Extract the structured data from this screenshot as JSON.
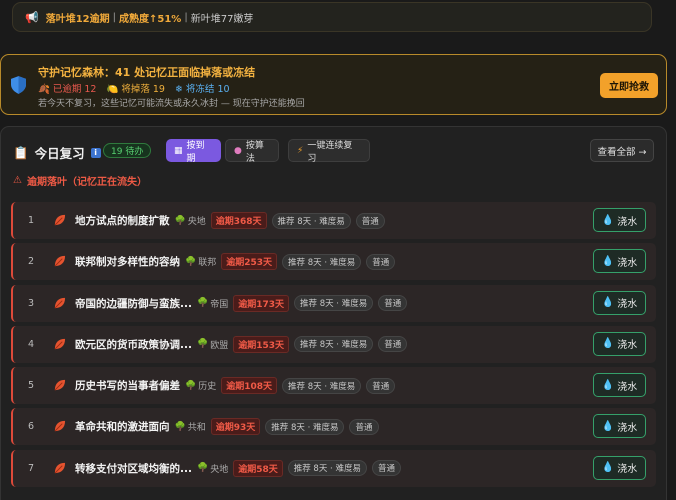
{
  "top_banner": {
    "icon": "megaphone-icon",
    "overdue": "落叶堆12逾期",
    "ripeness": "成熟度↑51%",
    "sprouts": "新叶堆77嫩芽",
    "sep": "|"
  },
  "alert": {
    "title": "守护记忆森林：41 处记忆正面临掉落或冻结",
    "stat_overdue": "已逾期 12",
    "stat_falling": "将掉落 19",
    "stat_frozen": "将冻结 10",
    "subtitle": "若今天不复习，这些记忆可能流失或永久冰封 — 现在守护还能挽回",
    "button": "立即抢救"
  },
  "review": {
    "title": "今日复习",
    "pending": "19 待办",
    "sort_due": "按到期",
    "sort_algo": "按算法",
    "continuous": "一键连续复习",
    "view_all": "查看全部 →",
    "section_title": "逾期落叶（记忆正在流失）",
    "water_label": "浇水",
    "items": [
      {
        "num": "1",
        "name": "地方试点的制度扩散",
        "tree": "央地",
        "overdue": "逾期368天",
        "rec": "推荐 8天 · 难度易",
        "level": "普通"
      },
      {
        "num": "2",
        "name": "联邦制对多样性的容纳",
        "tree": "联邦",
        "overdue": "逾期253天",
        "rec": "推荐 8天 · 难度易",
        "level": "普通"
      },
      {
        "num": "3",
        "name": "帝国的边疆防御与蛮族...",
        "tree": "帝国",
        "overdue": "逾期173天",
        "rec": "推荐 8天 · 难度易",
        "level": "普通"
      },
      {
        "num": "4",
        "name": "欧元区的货币政策协调...",
        "tree": "欧盟",
        "overdue": "逾期153天",
        "rec": "推荐 8天 · 难度易",
        "level": "普通"
      },
      {
        "num": "5",
        "name": "历史书写的当事者偏差",
        "tree": "历史",
        "overdue": "逾期108天",
        "rec": "推荐 8天 · 难度易",
        "level": "普通"
      },
      {
        "num": "6",
        "name": "革命共和的激进面向",
        "tree": "共和",
        "overdue": "逾期93天",
        "rec": "推荐 8天 · 难度易",
        "level": "普通"
      },
      {
        "num": "7",
        "name": "转移支付对区域均衡的...",
        "tree": "央地",
        "overdue": "逾期58天",
        "rec": "推荐 8天 · 难度易",
        "level": "普通"
      }
    ]
  },
  "colors": {
    "accent": "#7b59e0",
    "overdue": "#f05a47",
    "warning": "#f2a12a",
    "water": "#35a06a"
  }
}
